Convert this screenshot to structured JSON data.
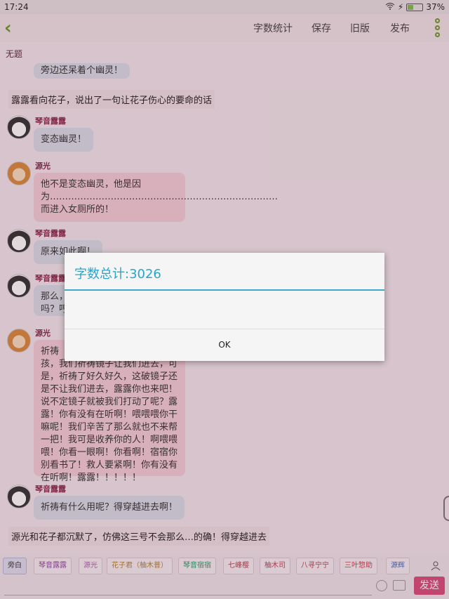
{
  "status": {
    "time": "17:24",
    "battery": "37%",
    "battery_level": 0.37
  },
  "toolbar": {
    "word_count": "字数统计",
    "save": "保存",
    "old_version": "旧版",
    "publish": "发布"
  },
  "doc": {
    "title": "无题"
  },
  "messages": [
    {
      "text": "旁边还呆着个幽灵！"
    },
    {
      "text": "露露看向花子，说出了一句让花子伤心的要命的话"
    },
    {
      "name": "琴音露露",
      "text": "变态幽灵！"
    },
    {
      "name": "源光",
      "text": "他不是变态幽灵，他是因为…………………………………………………………………而进入女厕所的！"
    },
    {
      "name": "琴音露露",
      "text": "原来如此啊！"
    },
    {
      "name": "琴音露露",
      "text": "那么，",
      "text2": "吗？哼"
    },
    {
      "name": "源光",
      "text": "祈祷",
      "text2": "孩，我们祈祷镜子让我们进去，可是，祈祷了好久好久，这破镜子还是不让我们进去，露露你也来吧！说不定镜子就被我们打动了呢？露露！你有没有在听啊！喂喂喂你干嘛呢！我们辛苦了那么就也不来帮一把！我可是收养你的人！啊喂喂喂！你看一眼啊！你看啊！宿宿你别看书了！救人要紧啊！你有没有在听啊！露露！！！！！"
    },
    {
      "name": "琴音露露",
      "text": "祈祷有什么用呢？得穿越进去啊！"
    },
    {
      "text": "源光和花子都沉默了，仿佛这三号不会那么…的确！得穿越进去"
    }
  ],
  "dialog": {
    "title": "字数总计:3026",
    "ok": "OK"
  },
  "characters": [
    "旁白",
    "琴音露露",
    "源光",
    "花子君（柚木普）",
    "琴音宿宿",
    "七峰樱",
    "柚木司",
    "八寻宁宁",
    "三叶惣助",
    "源辉"
  ],
  "input": {
    "send": "发送"
  }
}
